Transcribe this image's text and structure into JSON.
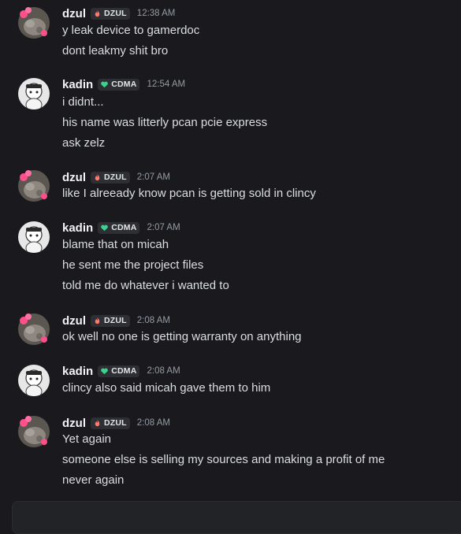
{
  "colors": {
    "background": "#1a1a1e",
    "username": "#f2f3f5",
    "message_text": "#dbdee1",
    "timestamp": "#949ba4",
    "tag_bg": "#2e2f34"
  },
  "messages": [
    {
      "author": "dzul",
      "tag": "DZUL",
      "tag_icon": "flame-icon",
      "avatar": "dzul-avatar",
      "time": "12:38 AM",
      "lines": [
        "y leak device to gamerdoc",
        "dont leakmy shit bro"
      ]
    },
    {
      "author": "kadin",
      "tag": "CDMA",
      "tag_icon": "heart-icon",
      "avatar": "kadin-avatar",
      "time": "12:54 AM",
      "lines": [
        "i didnt...",
        "his name was litterly pcan pcie express",
        "ask zelz"
      ]
    },
    {
      "author": "dzul",
      "tag": "DZUL",
      "tag_icon": "flame-icon",
      "avatar": "dzul-avatar",
      "time": "2:07 AM",
      "lines": [
        "like I alreeady know pcan is getting sold in clincy"
      ]
    },
    {
      "author": "kadin",
      "tag": "CDMA",
      "tag_icon": "heart-icon",
      "avatar": "kadin-avatar",
      "time": "2:07 AM",
      "lines": [
        "blame that on micah",
        "he sent me the project files",
        "told me do whatever i wanted to"
      ]
    },
    {
      "author": "dzul",
      "tag": "DZUL",
      "tag_icon": "flame-icon",
      "avatar": "dzul-avatar",
      "time": "2:08 AM",
      "lines": [
        "ok well no one is getting warranty on anything"
      ]
    },
    {
      "author": "kadin",
      "tag": "CDMA",
      "tag_icon": "heart-icon",
      "avatar": "kadin-avatar",
      "time": "2:08 AM",
      "lines": [
        "clincy also said micah gave them to him"
      ]
    },
    {
      "author": "dzul",
      "tag": "DZUL",
      "tag_icon": "flame-icon",
      "avatar": "dzul-avatar",
      "time": "2:08 AM",
      "lines": [
        "Yet again",
        "someone else is selling my sources and making a profit of me",
        "never again"
      ]
    }
  ]
}
